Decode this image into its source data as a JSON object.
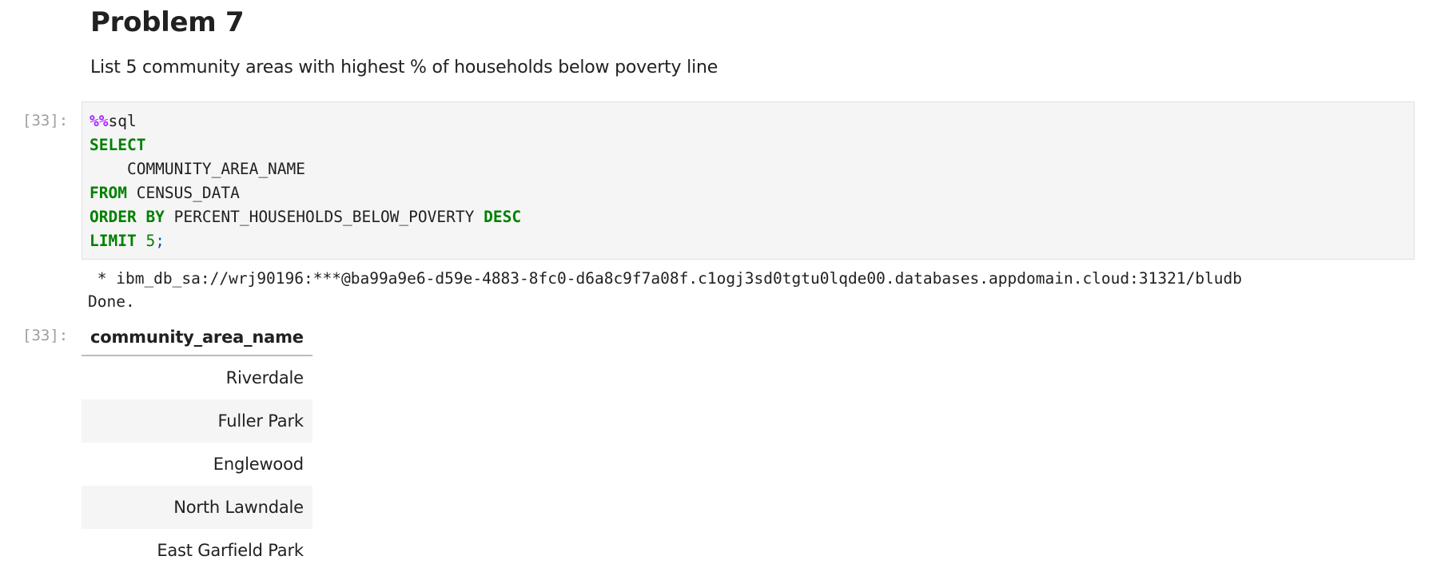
{
  "markdown": {
    "heading": "Problem 7",
    "description": "List 5 community areas with highest % of households below poverty line"
  },
  "code_cell": {
    "prompt": "[33]:",
    "lines": {
      "l1_magic": "%%",
      "l1_rest": "sql",
      "l2_kw": "SELECT",
      "l3_text": "    COMMUNITY_AREA_NAME",
      "l4_kw": "FROM",
      "l4_rest": " CENSUS_DATA",
      "l5_kw1": "ORDER BY",
      "l5_mid": " PERCENT_HOUSEHOLDS_BELOW_POVERTY ",
      "l5_kw2": "DESC",
      "l6_kw": "LIMIT",
      "l6_num": " 5",
      "l6_punc": ";"
    }
  },
  "output": {
    "connection": " * ibm_db_sa://wrj90196:***@ba99a9e6-d59e-4883-8fc0-d6a8c9f7a08f.c1ogj3sd0tgtu0lqde00.databases.appdomain.cloud:31321/bludb",
    "status": "Done.",
    "prompt": "[33]:",
    "table": {
      "header": "community_area_name",
      "rows": [
        "Riverdale",
        "Fuller Park",
        "Englewood",
        "North Lawndale",
        "East Garfield Park"
      ]
    }
  },
  "colors": {
    "magic": "#aa22ff",
    "keyword": "#008000",
    "prompt": "#9e9e9e",
    "cell_background": "#f5f5f5"
  }
}
